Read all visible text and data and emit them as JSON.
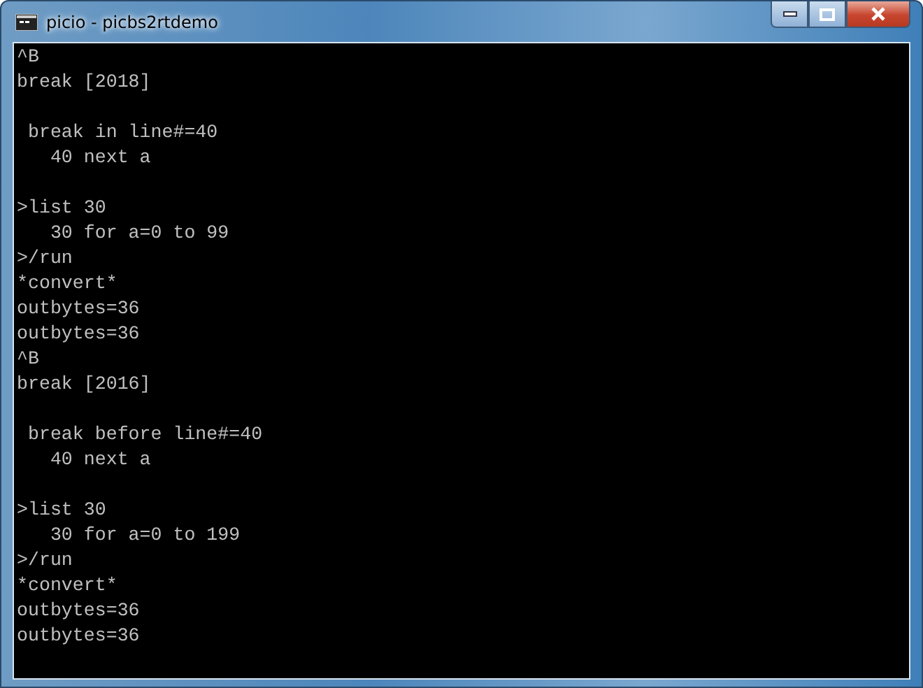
{
  "window": {
    "title": "picio - picbs2rtdemo"
  },
  "console": {
    "blocks": [
      [
        "^B",
        "break [2018]"
      ],
      [
        " break in line#=40",
        "   40 next a"
      ],
      [
        ">list 30",
        "   30 for a=0 to 99",
        ">/run",
        "*convert*",
        "outbytes=36",
        "outbytes=36",
        "^B",
        "break [2016]"
      ],
      [
        " break before line#=40",
        "   40 next a"
      ],
      [
        ">list 30",
        "   30 for a=0 to 199",
        ">/run",
        "*convert*",
        "outbytes=36",
        "outbytes=36"
      ]
    ]
  }
}
